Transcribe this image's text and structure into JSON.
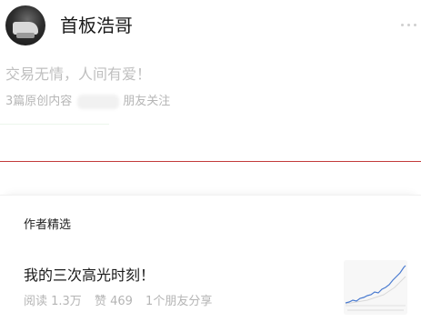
{
  "profile": {
    "name": "首板浩哥",
    "bio": "交易无情，人间有爱！",
    "original_count_text": "3篇原创内容",
    "friends_follow_text": "朋友关注"
  },
  "featured": {
    "section_title": "作者精选",
    "article": {
      "title": "我的三次高光时刻！",
      "reads": "阅读 1.3万",
      "likes": "赞 469",
      "friends_share": "1个朋友分享"
    }
  },
  "icons": {
    "more": "more-dots-icon",
    "avatar": "avatar-image",
    "thumbnail": "stock-chart-thumbnail"
  },
  "colors": {
    "divider_red": "#c23a3a",
    "muted_text": "#b5b5b5"
  }
}
